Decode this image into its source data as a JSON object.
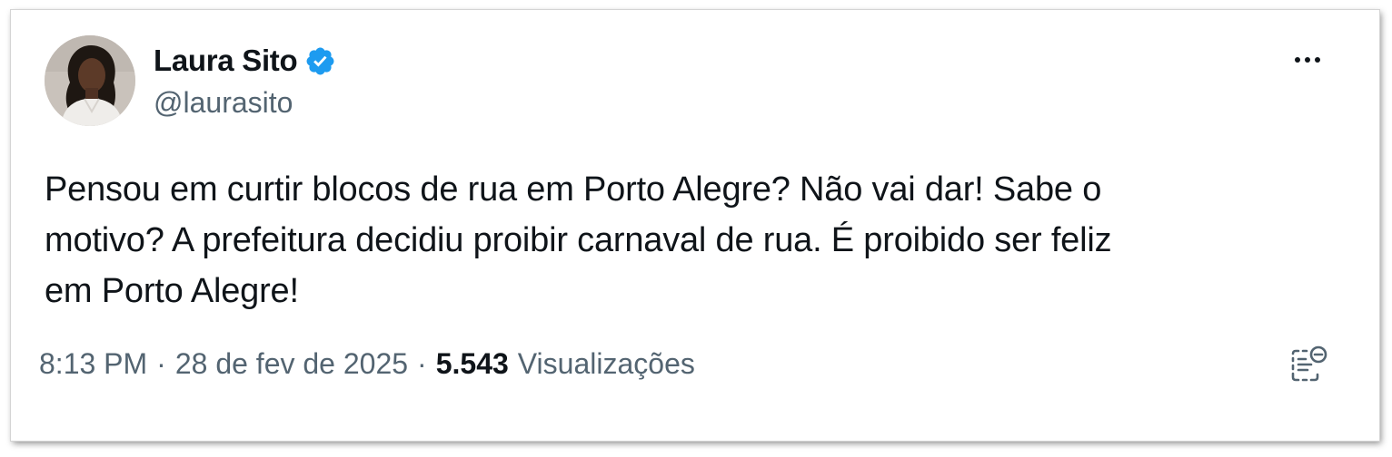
{
  "author": {
    "display_name": "Laura Sito",
    "handle": "@laurasito",
    "verified": true,
    "verified_color": "#1d9bf0",
    "avatar_icon": "profile-photo"
  },
  "tweet": {
    "text_lines": [
      "Pensou em curtir blocos de rua em Porto Alegre? Não vai dar! Sabe o",
      "motivo? A prefeitura decidiu proibir carnaval de rua. É proibido ser feliz",
      "em Porto Alegre!"
    ]
  },
  "meta": {
    "time": "8:13 PM",
    "separator": "·",
    "date": "28 de fev de 2025",
    "views_count": "5.543",
    "views_label": "Visualizações"
  },
  "icons": {
    "more": "more-options-icon",
    "notes": "community-notes-icon"
  },
  "colors": {
    "text_primary": "#0f1419",
    "text_secondary": "#536471",
    "accent": "#1d9bf0"
  }
}
